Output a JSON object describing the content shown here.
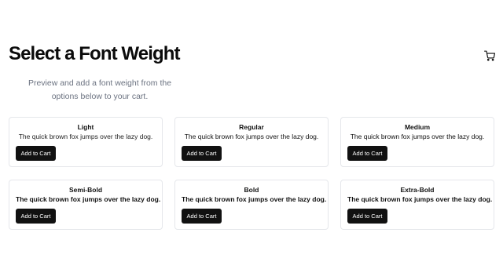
{
  "header": {
    "title": "Select a Font Weight",
    "cart_icon": "shopping-cart-icon"
  },
  "subtitle": "Preview and add a font weight from the options below to your cart.",
  "cards": [
    {
      "label": "Light",
      "sample": "The quick brown fox jumps over the lazy dog.",
      "button": "Add to Cart"
    },
    {
      "label": "Regular",
      "sample": "The quick brown fox jumps over the lazy dog.",
      "button": "Add to Cart"
    },
    {
      "label": "Medium",
      "sample": "The quick brown fox jumps over the lazy dog.",
      "button": "Add to Cart"
    },
    {
      "label": "Semi-Bold",
      "sample": "The quick brown fox jumps over the lazy dog.",
      "button": "Add to Cart"
    },
    {
      "label": "Bold",
      "sample": "The quick brown fox jumps over the lazy dog.",
      "button": "Add to Cart"
    },
    {
      "label": "Extra-Bold",
      "sample": "The quick brown fox jumps over the lazy dog.",
      "button": "Add to Cart"
    }
  ],
  "colors": {
    "button_bg": "#111111",
    "button_text": "#ffffff",
    "card_border": "#e5e7eb",
    "subtitle_text": "#6b7280"
  }
}
